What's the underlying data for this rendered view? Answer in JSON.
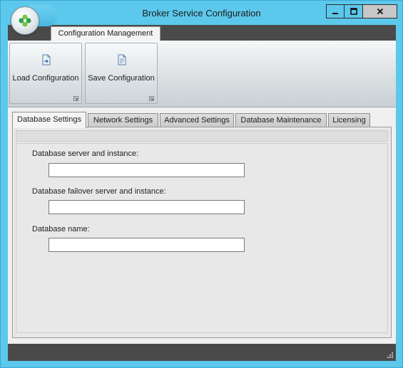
{
  "window": {
    "title": "Broker Service Configuration",
    "colors": {
      "frame": "#5cc8ec",
      "menubar": "#4a4a4a",
      "accent": "#2ea34b"
    }
  },
  "menubar": {
    "tabs": [
      {
        "label": "Configuration Management",
        "icon": ""
      }
    ]
  },
  "ribbon": {
    "buttons": [
      {
        "label": "Load Configuration",
        "icon": "load-config-icon"
      },
      {
        "label": "Save Configuration",
        "icon": "save-config-icon"
      }
    ]
  },
  "tabs": [
    {
      "label": "Database Settings",
      "active": true
    },
    {
      "label": "Network Settings",
      "active": false
    },
    {
      "label": "Advanced Settings",
      "active": false
    },
    {
      "label": "Database Maintenance",
      "active": false
    },
    {
      "label": "Licensing",
      "active": false
    }
  ],
  "form": {
    "fields": [
      {
        "label": "Database server and instance:",
        "value": ""
      },
      {
        "label": "Database failover server and instance:",
        "value": ""
      },
      {
        "label": "Database name:",
        "value": ""
      }
    ]
  }
}
